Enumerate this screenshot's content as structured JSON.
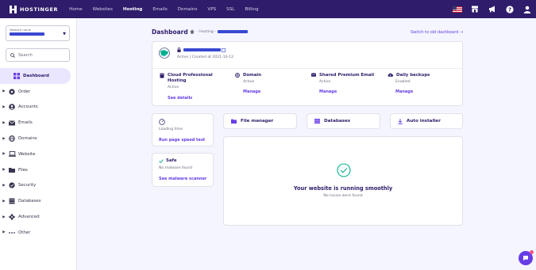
{
  "brand": {
    "name": "HOSTINGER"
  },
  "nav": [
    "Home",
    "Websites",
    "Hosting",
    "Emails",
    "Domains",
    "VPS",
    "SSL",
    "Billing"
  ],
  "nav_active": "Hosting",
  "sidebar": {
    "website_label": "Website name",
    "search_placeholder": "Search",
    "items": [
      "Dashboard",
      "Order",
      "Accounts",
      "Emails",
      "Domains",
      "Website",
      "Files",
      "Security",
      "Databases",
      "Advanced",
      "Other"
    ]
  },
  "header": {
    "title": "Dashboard",
    "breadcrumb": "- Hosting -",
    "switch_link": "Switch to old dashboard →"
  },
  "site": {
    "status": "Active | Created at 2021-10-12",
    "plan": {
      "title": "Cloud Professional Hosting",
      "status": "Active",
      "action": "See details"
    },
    "domain": {
      "title": "Domain",
      "status": "Active",
      "action": "Manage"
    },
    "email": {
      "title": "Shared Premium Email",
      "status": "Active",
      "action": "Manage"
    },
    "backups": {
      "title": "Daily backups",
      "status": "Enabled",
      "action": "Manage"
    }
  },
  "speed": {
    "label": "Loading time",
    "action": "Run page speed test"
  },
  "security": {
    "title": "Safe",
    "status": "No malware found",
    "action": "See malware scanner"
  },
  "quick_links": [
    "File manager",
    "Databases",
    "Auto installer"
  ],
  "health": {
    "title": "Your website is running smoothly",
    "subtitle": "No issues were found"
  },
  "colors": {
    "accent": "#673de6",
    "navy": "#2f1c6a",
    "success": "#00b090"
  }
}
